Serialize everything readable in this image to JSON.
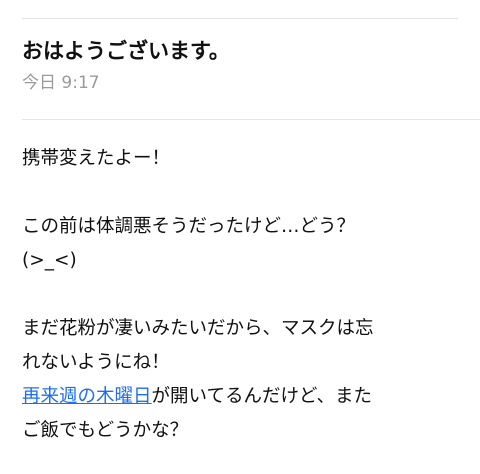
{
  "message": {
    "subject": "おはようございます。",
    "timestamp": "今日 9:17"
  },
  "body": {
    "paragraph1": "携帯変えたよー！",
    "paragraph2_line1": "この前は体調悪そうだったけど…どう？",
    "paragraph2_line2": "(>_<)",
    "paragraph3_line1": "まだ花粉が凄いみたいだから、マスクは忘",
    "paragraph3_line2": "れないようにね！",
    "paragraph3_link": "再来週の木曜日",
    "paragraph3_line3_rest": "が開いてるんだけど、また",
    "paragraph3_line4": "ご飯でもどうかな？"
  },
  "colors": {
    "link": "#1e6ff0",
    "timestamp": "#9b9b9b",
    "divider": "#e3e3e3"
  }
}
